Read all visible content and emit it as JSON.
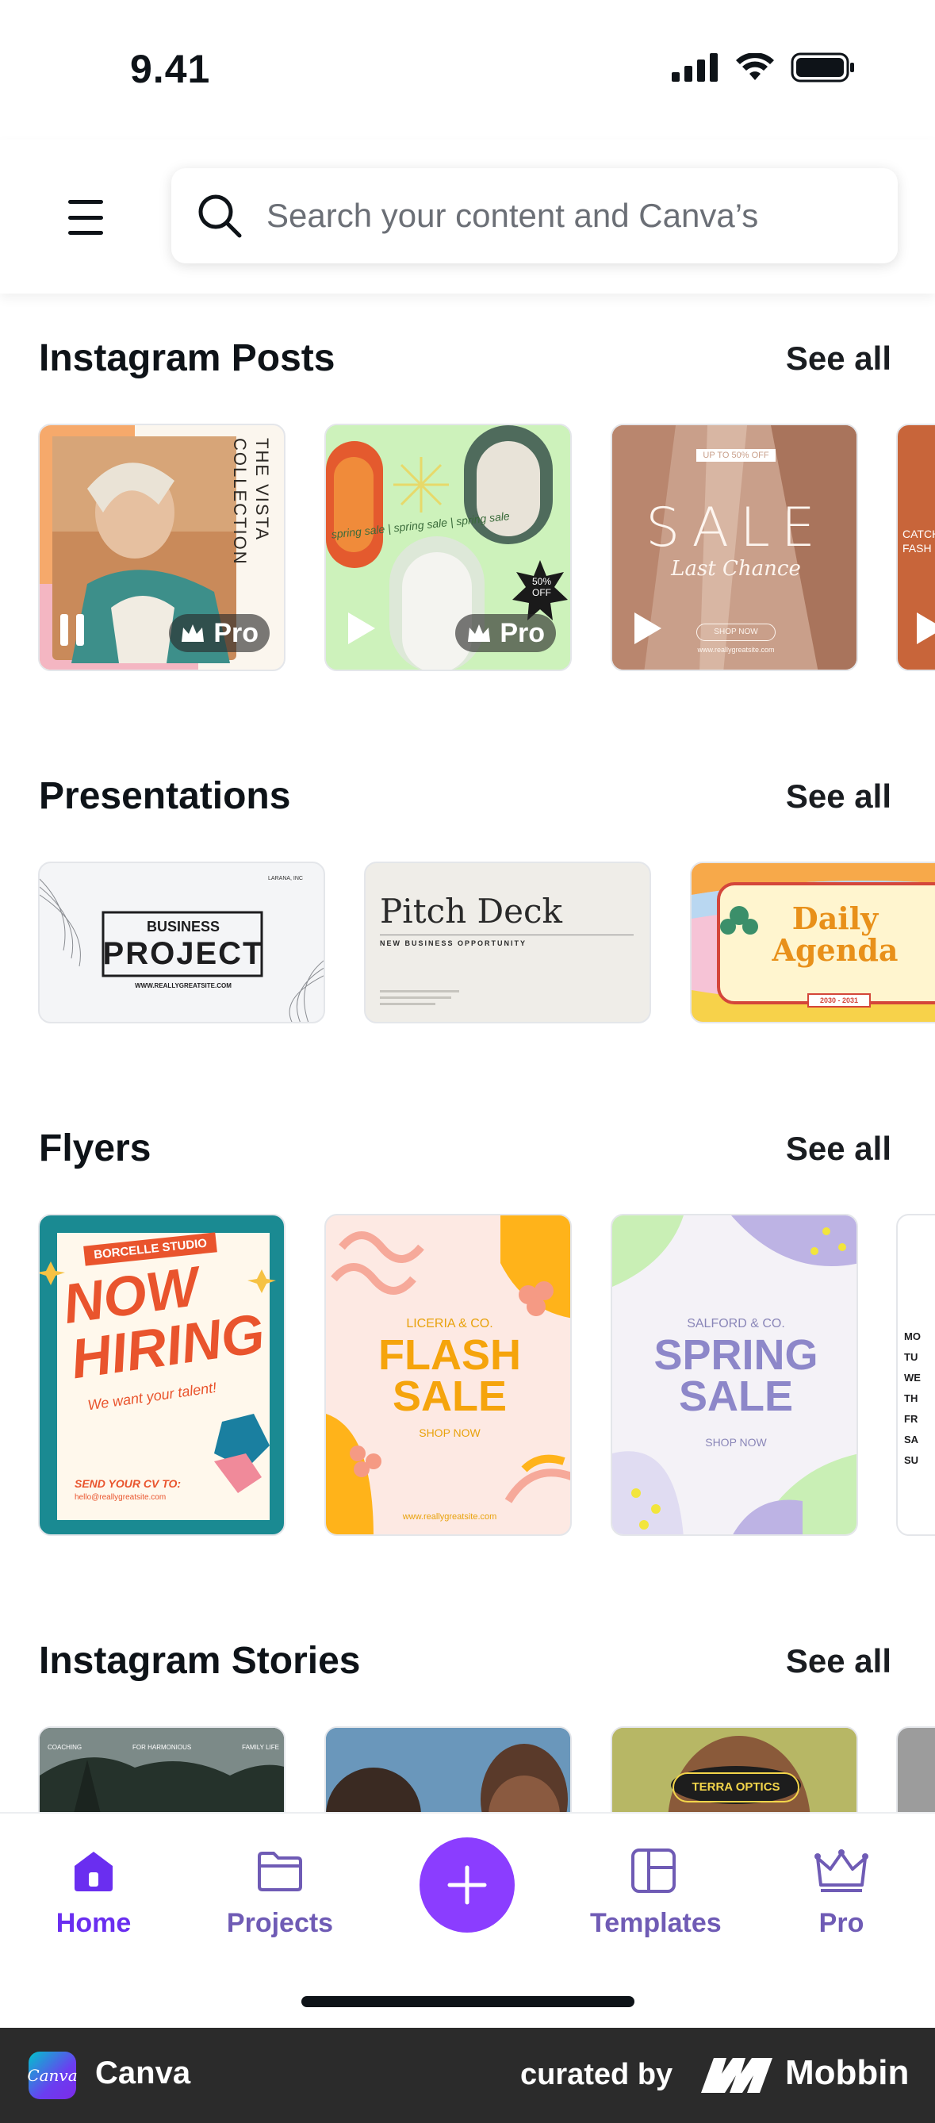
{
  "status_bar": {
    "time": "9.41"
  },
  "search": {
    "placeholder": "Search your content and Canva’s"
  },
  "sections": {
    "instagram_posts": {
      "title": "Instagram Posts",
      "see_all": "See all",
      "cards": [
        {
          "texts": [
            "THE VISTA",
            "COLLECTION"
          ],
          "badge": "Pro"
        },
        {
          "texts": [
            "spring sale | spring sale | spring sale",
            "50%",
            "OFF"
          ],
          "badge": "Pro"
        },
        {
          "texts": [
            "UP TO 50% OFF",
            "SALE",
            "Last Chance",
            "SHOP NOW",
            "www.reallygreatsite.com"
          ]
        },
        {
          "texts": [
            "CATCH",
            "FASH"
          ]
        }
      ]
    },
    "presentations": {
      "title": "Presentations",
      "see_all": "See all",
      "cards": [
        {
          "texts": [
            "BUSINESS",
            "PROJECT",
            "WWW.REALLYGREATSITE.COM",
            "LARANA, INC"
          ]
        },
        {
          "texts": [
            "Pitch Deck",
            "NEW BUSINESS OPPORTUNITY"
          ]
        },
        {
          "texts": [
            "Daily",
            "Agenda",
            "2030 - 2031"
          ]
        }
      ]
    },
    "flyers": {
      "title": "Flyers",
      "see_all": "See all",
      "cards": [
        {
          "texts": [
            "BORCELLE STUDIO",
            "NOW",
            "HIRING",
            "We want your talent!",
            "SEND YOUR CV TO:",
            "hello@reallygreatsite.com"
          ]
        },
        {
          "texts": [
            "LICERIA & CO.",
            "FLASH",
            "SALE",
            "SHOP NOW",
            "www.reallygreatsite.com"
          ]
        },
        {
          "texts": [
            "SALFORD & CO.",
            "SPRING",
            "SALE",
            "SHOP NOW"
          ]
        },
        {
          "texts": [
            "MO",
            "TU",
            "WE",
            "TH",
            "FR",
            "SA",
            "SU"
          ]
        }
      ]
    },
    "instagram_stories": {
      "title": "Instagram Stories",
      "see_all": "See all",
      "cards": [
        {
          "texts": [
            "COACHING",
            "FOR HARMONIOUS",
            "FAMILY LIFE"
          ]
        },
        {
          "texts": []
        },
        {
          "texts": [
            "TERRA OPTICS"
          ]
        },
        {
          "texts": []
        }
      ]
    }
  },
  "bottom_nav": {
    "items": [
      {
        "label": "Home",
        "icon": "home-icon",
        "active": true
      },
      {
        "label": "Projects",
        "icon": "folder-icon"
      },
      {
        "label": "Templates",
        "icon": "templates-icon"
      },
      {
        "label": "Pro",
        "icon": "crown-icon"
      }
    ],
    "create_icon": "plus-icon"
  },
  "footer": {
    "app_name": "Canva",
    "logo_text": "Canva",
    "curated_by": "curated by",
    "brand": "Mobbin"
  },
  "colors": {
    "accent": "#8b3dff",
    "nav_active": "#6a2ef0",
    "nav_inactive": "#6f5bb5",
    "footer_bg": "#2b2b2b"
  }
}
